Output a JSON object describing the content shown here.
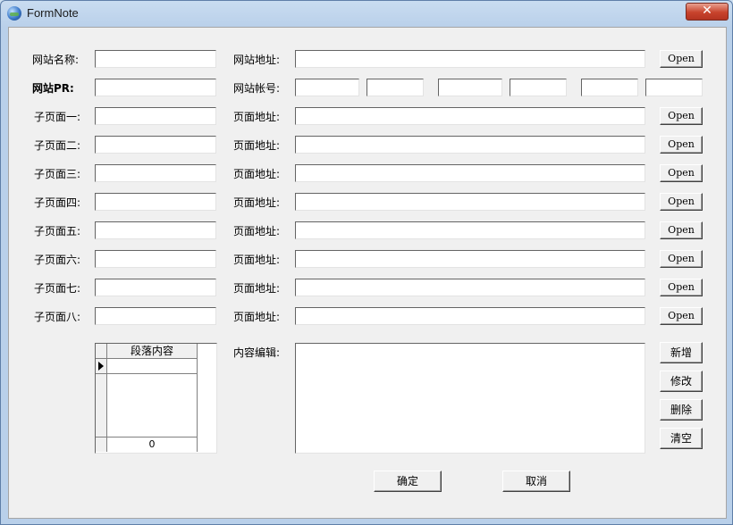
{
  "window": {
    "title": "FormNote",
    "close_glyph": "✕"
  },
  "form": {
    "site_name_label": "网站名称:",
    "site_url_label": "网站地址:",
    "site_pr_label": "网站PR:",
    "site_account_label": "网站帐号:",
    "open_label": "Open",
    "subpages": [
      {
        "label": "子页面一:",
        "url_label": "页面地址:"
      },
      {
        "label": "子页面二:",
        "url_label": "页面地址:"
      },
      {
        "label": "子页面三:",
        "url_label": "页面地址:"
      },
      {
        "label": "子页面四:",
        "url_label": "页面地址:"
      },
      {
        "label": "子页面五:",
        "url_label": "页面地址:"
      },
      {
        "label": "子页面六:",
        "url_label": "页面地址:"
      },
      {
        "label": "子页面七:",
        "url_label": "页面地址:"
      },
      {
        "label": "子页面八:",
        "url_label": "页面地址:"
      }
    ],
    "grid": {
      "header": "段落内容",
      "footer_count": "0"
    },
    "content_edit_label": "内容编辑:",
    "side_buttons": {
      "add": "新增",
      "modify": "修改",
      "delete": "删除",
      "clear": "清空"
    },
    "ok_label": "确定",
    "cancel_label": "取消"
  }
}
